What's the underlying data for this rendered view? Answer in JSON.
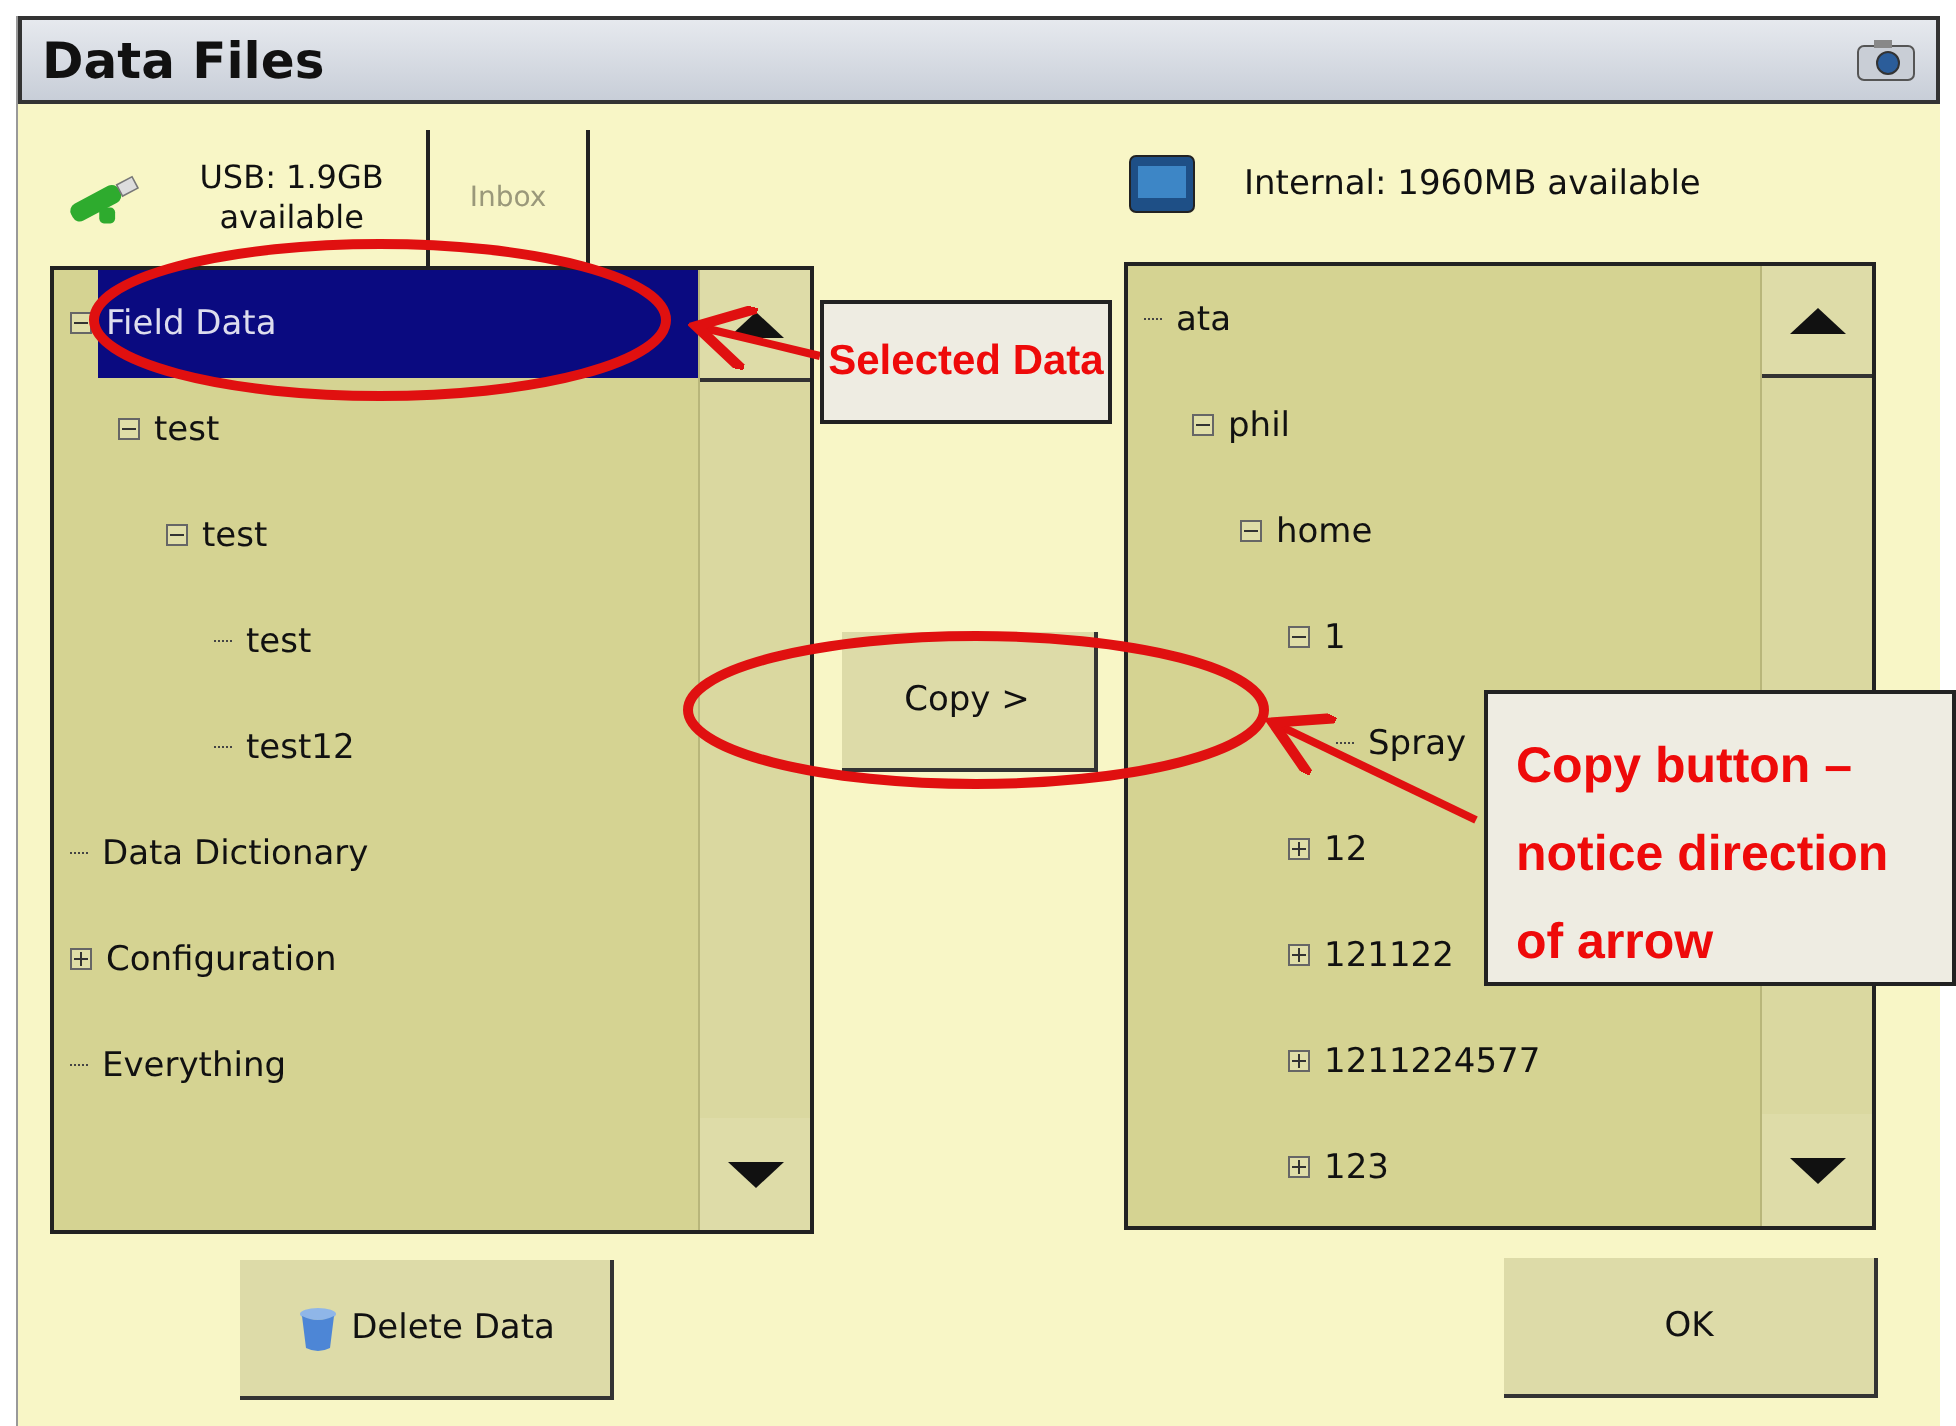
{
  "window": {
    "title": "Data Files"
  },
  "usb": {
    "label": "USB: 1.9GB available"
  },
  "inbox_tab": {
    "label": "Inbox",
    "disabled": true
  },
  "internal": {
    "label": "Internal: 1960MB available"
  },
  "left_tree": [
    {
      "label": "Field Data",
      "selected": true,
      "expanded": true,
      "children": [
        {
          "label": "test",
          "selected": false,
          "expanded": true,
          "children": [
            {
              "label": "test",
              "selected": false,
              "expanded": true,
              "children": [
                {
                  "label": "test",
                  "selected": false
                },
                {
                  "label": "test12",
                  "selected": false
                }
              ]
            }
          ]
        }
      ]
    },
    {
      "label": "Data Dictionary",
      "selected": false
    },
    {
      "label": "Configuration",
      "selected": false,
      "expanded": false
    },
    {
      "label": "Everything",
      "selected": false
    }
  ],
  "right_tree": [
    {
      "label": "ata",
      "selected": false,
      "children": [
        {
          "label": "phil",
          "selected": false,
          "expanded": true,
          "children": [
            {
              "label": "home",
              "selected": false,
              "expanded": true,
              "children": [
                {
                  "label": "1",
                  "selected": false,
                  "expanded": true,
                  "children": [
                    {
                      "label": "Spray",
                      "selected": false
                    }
                  ]
                },
                {
                  "label": "12",
                  "selected": false,
                  "expanded": false
                },
                {
                  "label": "121122",
                  "selected": false,
                  "expanded": false
                },
                {
                  "label": "1211224577",
                  "selected": false,
                  "expanded": false
                },
                {
                  "label": "123",
                  "selected": false,
                  "expanded": false
                }
              ]
            }
          ]
        }
      ]
    }
  ],
  "copy_button": "Copy >",
  "delete_button": "Delete Data",
  "ok_button": "OK",
  "annotations": [
    {
      "text": "Selected Data"
    },
    {
      "text": "Copy button – notice direction of arrow"
    }
  ]
}
